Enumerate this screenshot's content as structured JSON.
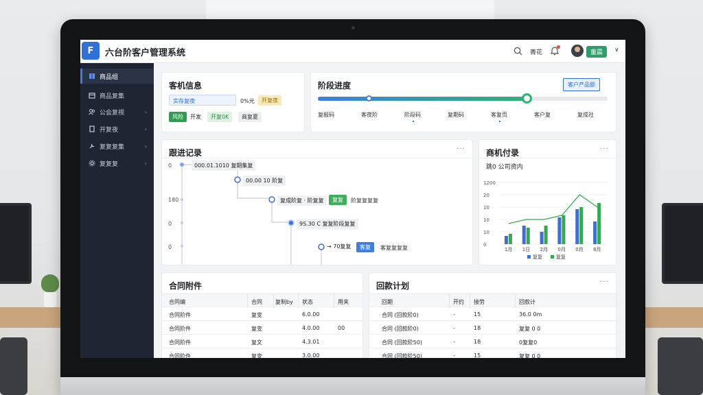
{
  "app": {
    "logo_text": "F",
    "title": "六台阶客户管理系统"
  },
  "header": {
    "search_icon": "search-icon",
    "link_label": "菁花",
    "bell_icon": "bell-icon",
    "user_name": "董晨",
    "user_chevron": "∨"
  },
  "sidebar": {
    "items": [
      {
        "label": "商品组",
        "icon": "home-icon",
        "active": true,
        "chevron": ""
      },
      {
        "label": "商品复集",
        "icon": "box-icon",
        "active": false,
        "chevron": ""
      },
      {
        "label": "公会复视",
        "icon": "team-icon",
        "active": false,
        "chevron": "›"
      },
      {
        "label": "开复夜",
        "icon": "file-icon",
        "active": false,
        "chevron": "›"
      },
      {
        "label": "复复复集",
        "icon": "tool-icon",
        "active": false,
        "chevron": "›"
      },
      {
        "label": "复复复",
        "icon": "gear-icon",
        "active": false,
        "chevron": "›"
      }
    ]
  },
  "customer_card": {
    "title": "客机信息",
    "input_value": "实存复夜",
    "amount": "0%元",
    "tag_orange": "开复夜",
    "tag_green1": "风险",
    "tag_text": "开发",
    "tag_green2": "开复0K",
    "tag_gray": "商复夏"
  },
  "stage_card": {
    "title": "阶段进度",
    "button_label": "客户产品额",
    "progress": 0.72,
    "stages": [
      "复报码",
      "客夜阶",
      "阶段码",
      "复期码",
      "客复页",
      "客户复",
      "复成社"
    ]
  },
  "follow_card": {
    "title": "跟进记录",
    "more": "···",
    "left_labels": [
      "0",
      "180",
      "0",
      "0"
    ],
    "entries": [
      {
        "text": "000.01.1010 复期集复",
        "tag": "",
        "extra": ""
      },
      {
        "text": "00.00 10 阶复",
        "tag": "",
        "extra": ""
      },
      {
        "text": "复成阶复 · 阶复复",
        "tag": "复复",
        "extra": "阶复复复复"
      },
      {
        "text": "9S.30 C 复复阶段复复",
        "tag": "",
        "extra": ""
      },
      {
        "text": "→ 70复复",
        "tag": "客复",
        "extra": "客复复复复"
      }
    ]
  },
  "sales_card": {
    "title": "商机付录",
    "more": "···",
    "chart_data": {
      "type": "bar",
      "title": "跳0 公司资内",
      "categories": [
        "1月",
        "1日",
        "2月",
        "0月",
        "0月",
        "8月"
      ],
      "yticks": [
        "1200",
        "20",
        "10",
        "10",
        "10",
        "0"
      ],
      "ylim": [
        0,
        30
      ],
      "series": [
        {
          "name": "复复",
          "color": "#3f6fd0",
          "values": [
            4,
            9,
            6,
            13,
            17,
            11
          ]
        },
        {
          "name": "复复",
          "color": "#34a853",
          "values": [
            5,
            8,
            9,
            14,
            18,
            20
          ]
        }
      ],
      "line": [
        10,
        12,
        12,
        14,
        24,
        18
      ],
      "legend_position": "bottom",
      "grid": true
    }
  },
  "contract_card": {
    "title": "合同附件",
    "headers": [
      "合同编",
      "合同",
      "复制by",
      "状态",
      "用夹"
    ],
    "rows": [
      [
        "合同阶件",
        "复变",
        "",
        "6.0.00",
        ""
      ],
      [
        "合同阶件",
        "复变",
        "",
        "4.0.00",
        "00"
      ],
      [
        "合同阶件",
        "复文",
        "",
        "4.3.01",
        ""
      ],
      [
        "合同阶件",
        "复变",
        "",
        "3.0.00",
        ""
      ]
    ]
  },
  "payment_card": {
    "title": "回款计划",
    "more": "···",
    "headers": [
      "回期",
      "开约",
      "接劳",
      "回款计"
    ],
    "rows": [
      [
        "合同 (回款阶0)",
        "-",
        "15",
        "36.0 0m"
      ],
      [
        "合同 (回款阶0)",
        "-",
        "18",
        "复复 0 0"
      ],
      [
        "合同 (回款阶50)",
        "-",
        "18",
        "0复复0"
      ],
      [
        "合同 (回款阶50)",
        "-",
        "15",
        "复复 0 0"
      ]
    ]
  }
}
